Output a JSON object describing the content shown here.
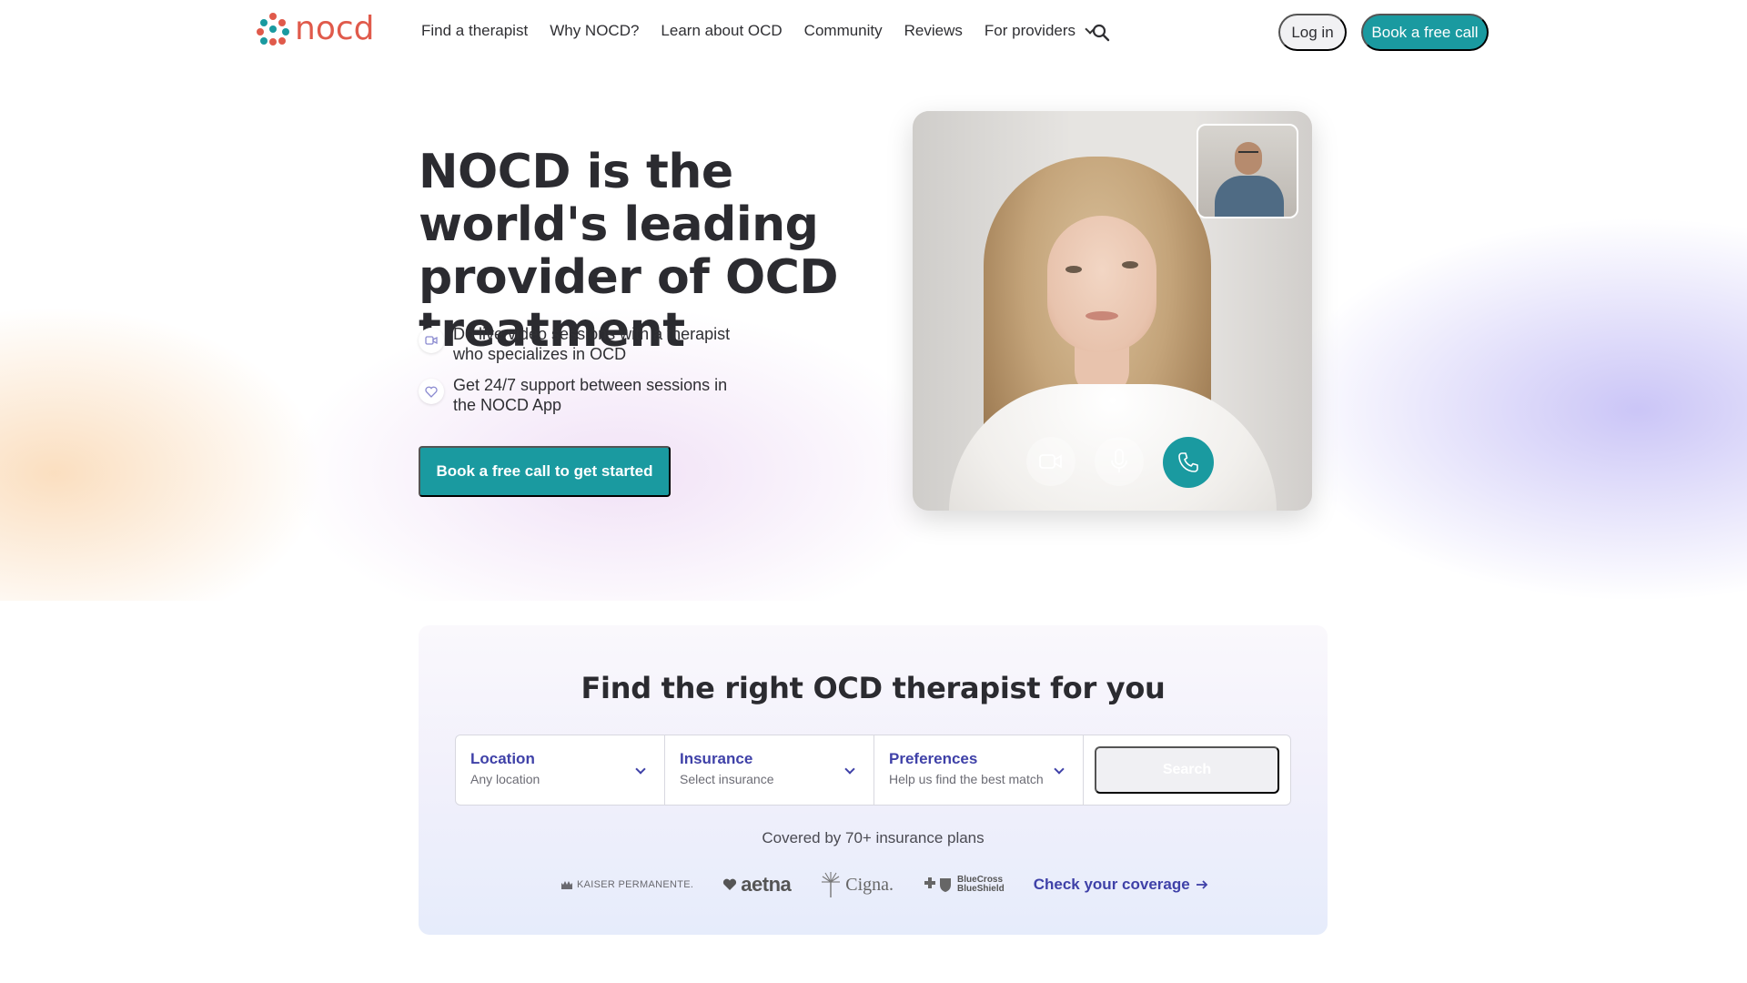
{
  "brand": {
    "name": "nocd",
    "accent": "#1a9aa0",
    "logo_color": "#e05a4b"
  },
  "nav": {
    "items": [
      {
        "label": "Find a therapist"
      },
      {
        "label": "Why NOCD?"
      },
      {
        "label": "Learn about OCD"
      },
      {
        "label": "Community"
      },
      {
        "label": "Reviews"
      },
      {
        "label": "For providers",
        "has_dropdown": true
      }
    ],
    "search_icon": "search-icon",
    "login_label": "Log in",
    "book_label": "Book a free call"
  },
  "hero": {
    "title": "NOCD is the world's leading provider of OCD treatment",
    "features": [
      {
        "icon": "video-camera-icon",
        "text": "Do live video sessions with a therapist who specializes in OCD"
      },
      {
        "icon": "heart-icon",
        "text": "Get 24/7 support between sessions in the NOCD App"
      }
    ],
    "cta_label": "Book a free call to get started",
    "video_controls": [
      "camera-icon",
      "microphone-icon",
      "phone-icon"
    ]
  },
  "finder": {
    "title": "Find the right OCD therapist for you",
    "fields": [
      {
        "label": "Location",
        "value": "Any location"
      },
      {
        "label": "Insurance",
        "value": "Select insurance"
      },
      {
        "label": "Preferences",
        "value": "Help us find the best match"
      }
    ],
    "search_label": "Search",
    "covered_text": "Covered by 70+ insurance plans",
    "insurers": {
      "kaiser": "KAISER PERMANENTE.",
      "aetna": "aetna",
      "cigna": "Cigna.",
      "bcbs_line1": "BlueCross",
      "bcbs_line2": "BlueShield"
    },
    "coverage_link": "Check your coverage"
  }
}
